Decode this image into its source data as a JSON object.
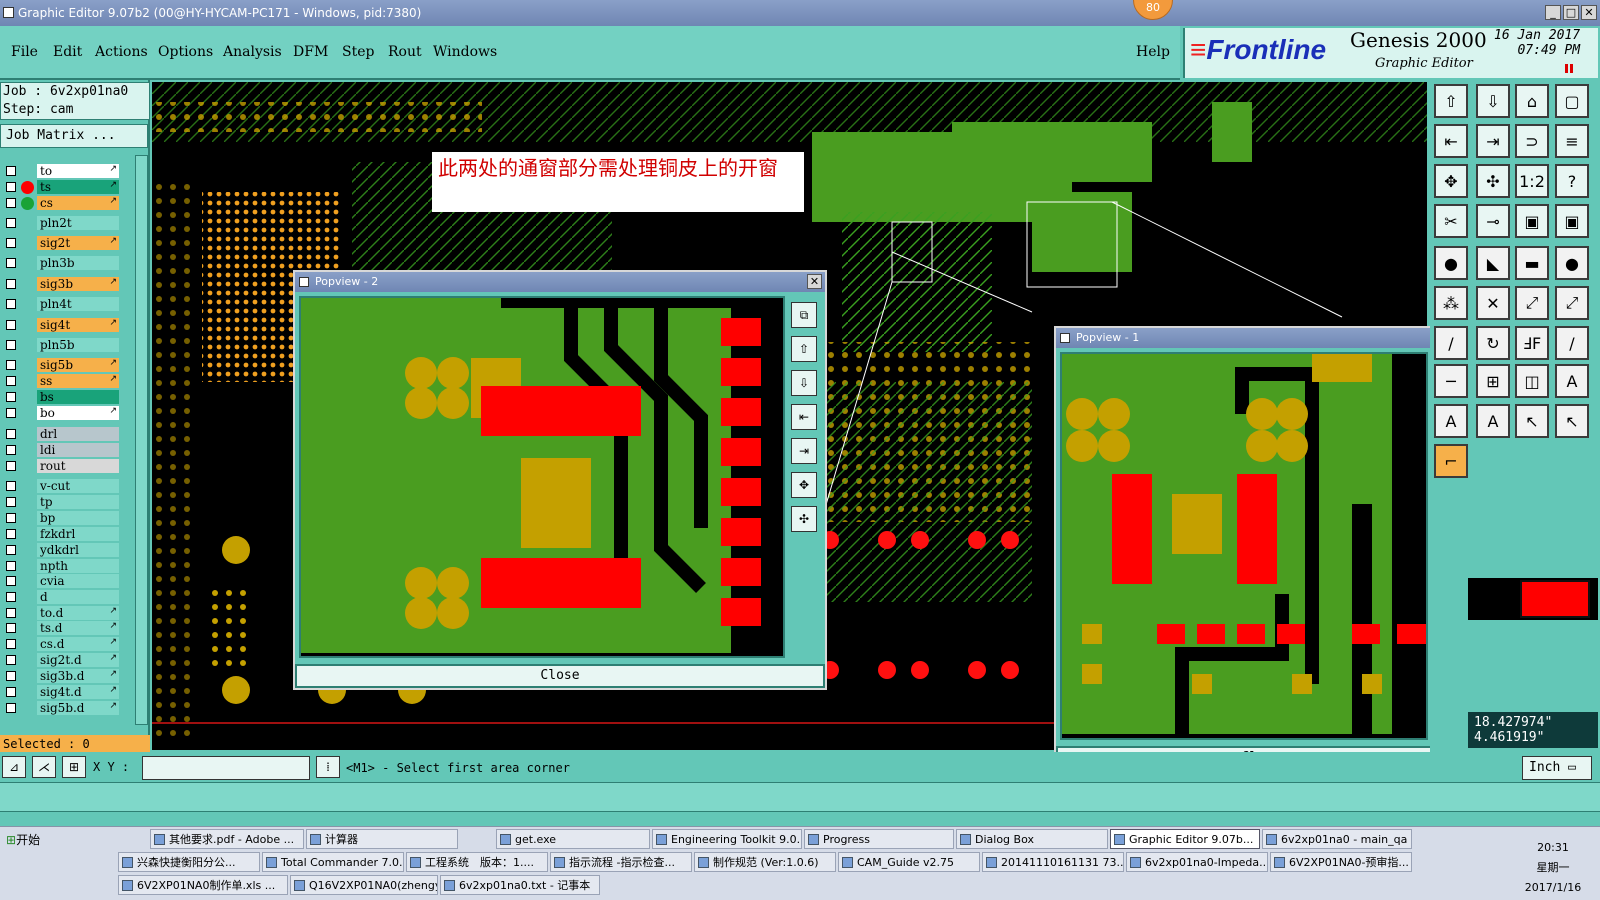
{
  "window": {
    "title": "Graphic Editor 9.07b2 (00@HY-HYCAM-PC171 - Windows, pid:7380)",
    "badge": "80"
  },
  "menu": [
    "File",
    "Edit",
    "Actions",
    "Options",
    "Analysis",
    "DFM",
    "Step",
    "Rout",
    "Windows"
  ],
  "help": "Help",
  "brand": {
    "logo": "Frontline",
    "product": "Genesis 2000",
    "subtitle": "Graphic Editor",
    "date": "16 Jan 2017",
    "time": "07:49 PM"
  },
  "job": {
    "job_line": "Job : 6v2xp01na0",
    "step_line": "Step: cam",
    "matrix": "Job Matrix ..."
  },
  "layers": [
    {
      "name": "to",
      "color": "#ffffff",
      "arrow": true,
      "mark": ""
    },
    {
      "name": "ts",
      "color": "#19a37a",
      "arrow": true,
      "mark": "red"
    },
    {
      "name": "cs",
      "color": "#f6b04a",
      "arrow": true,
      "mark": "green"
    },
    {
      "name": "pln2t",
      "color": "#7fd8c9",
      "arrow": false,
      "mark": ""
    },
    {
      "name": "sig2t",
      "color": "#f6b04a",
      "arrow": true,
      "mark": ""
    },
    {
      "name": "pln3b",
      "color": "#7fd8c9",
      "arrow": false,
      "mark": ""
    },
    {
      "name": "sig3b",
      "color": "#f6b04a",
      "arrow": true,
      "mark": ""
    },
    {
      "name": "pln4t",
      "color": "#7fd8c9",
      "arrow": false,
      "mark": ""
    },
    {
      "name": "sig4t",
      "color": "#f6b04a",
      "arrow": true,
      "mark": ""
    },
    {
      "name": "pln5b",
      "color": "#7fd8c9",
      "arrow": false,
      "mark": ""
    },
    {
      "name": "sig5b",
      "color": "#f6b04a",
      "arrow": true,
      "mark": ""
    },
    {
      "name": "ss",
      "color": "#f6b04a",
      "arrow": true,
      "mark": ""
    },
    {
      "name": "bs",
      "color": "#19a37a",
      "arrow": false,
      "mark": ""
    },
    {
      "name": "bo",
      "color": "#ffffff",
      "arrow": true,
      "mark": ""
    },
    {
      "name": "drl",
      "color": "#b7c6cc",
      "arrow": false,
      "mark": ""
    },
    {
      "name": "ldi",
      "color": "#b7c6cc",
      "arrow": false,
      "mark": ""
    },
    {
      "name": "rout",
      "color": "#d8d8d8",
      "arrow": false,
      "mark": ""
    },
    {
      "name": "v-cut",
      "color": "#7fd8c9",
      "arrow": false,
      "mark": ""
    },
    {
      "name": "tp",
      "color": "#7fd8c9",
      "arrow": false,
      "mark": ""
    },
    {
      "name": "bp",
      "color": "#7fd8c9",
      "arrow": false,
      "mark": ""
    },
    {
      "name": "fzkdrl",
      "color": "#7fd8c9",
      "arrow": false,
      "mark": ""
    },
    {
      "name": "ydkdrl",
      "color": "#7fd8c9",
      "arrow": false,
      "mark": ""
    },
    {
      "name": "npth",
      "color": "#7fd8c9",
      "arrow": false,
      "mark": ""
    },
    {
      "name": "cvia",
      "color": "#7fd8c9",
      "arrow": false,
      "mark": ""
    },
    {
      "name": "d",
      "color": "#7fd8c9",
      "arrow": false,
      "mark": ""
    },
    {
      "name": "to.d",
      "color": "#7fd8c9",
      "arrow": true,
      "mark": ""
    },
    {
      "name": "ts.d",
      "color": "#7fd8c9",
      "arrow": true,
      "mark": ""
    },
    {
      "name": "cs.d",
      "color": "#7fd8c9",
      "arrow": true,
      "mark": ""
    },
    {
      "name": "sig2t.d",
      "color": "#7fd8c9",
      "arrow": true,
      "mark": ""
    },
    {
      "name": "sig3b.d",
      "color": "#7fd8c9",
      "arrow": true,
      "mark": ""
    },
    {
      "name": "sig4t.d",
      "color": "#7fd8c9",
      "arrow": true,
      "mark": ""
    },
    {
      "name": "sig5b.d",
      "color": "#7fd8c9",
      "arrow": true,
      "mark": ""
    }
  ],
  "selected": "Selected : 0",
  "annotation": "此两处的通窗部分需处理铜皮上的开窗",
  "popview2": {
    "title": "Popview - 2",
    "close": "Close"
  },
  "popview1": {
    "title": "Popview - 1",
    "close": "Close"
  },
  "toolbar_glyphs": [
    "⇧",
    "⇩",
    "⌂",
    "▢",
    "⇤",
    "⇥",
    "⊃",
    "≡",
    "✥",
    "✣",
    "1:2",
    "?",
    "✂",
    "⊸",
    "▣",
    "▣",
    "●",
    "◣",
    "▬",
    "●",
    "⁂",
    "✕",
    "⤢",
    "⤢",
    "/",
    "↻",
    "ℲF",
    "/",
    "─",
    "⊞",
    "◫",
    "A",
    "A",
    "A",
    "↖",
    "↖",
    "⌐"
  ],
  "coords": {
    "x": "18.427974\"",
    "y": "4.461919\""
  },
  "statusbar": {
    "xy_label": "X Y :",
    "xy_value": "",
    "prompt": "<M1> - Select first area corner",
    "units": "Inch"
  },
  "taskbar": {
    "start": "开始",
    "row1": [
      "其他要求.pdf - Adobe ...",
      "计算器",
      "get.exe",
      "Engineering Toolkit 9.0...",
      "Progress",
      "Dialog Box",
      "Graphic Editor 9.07b...",
      "6v2xp01na0 - main_qa"
    ],
    "row2": [
      "兴森快捷衡阳分公...",
      "Total Commander 7.0...",
      "工程系统　版本：1....",
      "指示流程 -指示检查...",
      "制作规范 (Ver:1.0.6)",
      "CAM_Guide v2.75",
      "20141110161131 73....",
      "6v2xp01na0-Impeda...",
      "6V2XP01NA0-预审指..."
    ],
    "row3": [
      "6V2XP01NA0制作单.xls ...",
      "Q16V2XP01NA0(zhengyl...",
      "6v2xp01na0.txt - 记事本"
    ],
    "clock_time": "20:31",
    "clock_day": "星期一",
    "clock_date": "2017/1/16"
  }
}
